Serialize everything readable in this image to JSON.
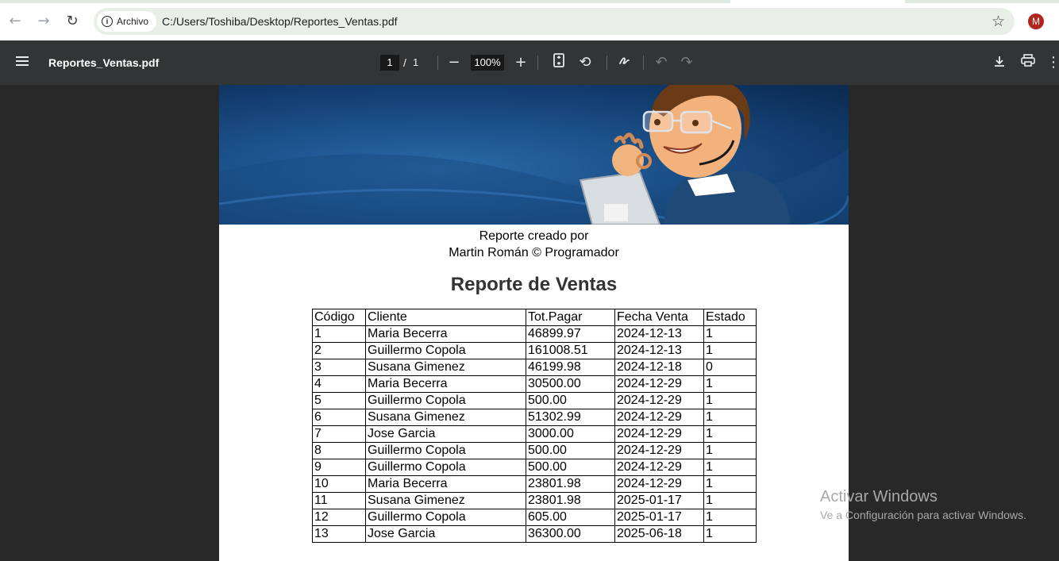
{
  "browser": {
    "security_chip": "Archivo",
    "url": "C:/Users/Toshiba/Desktop/Reportes_Ventas.pdf",
    "profile_initial": "M",
    "profile_color": "#b3261e"
  },
  "pdf_toolbar": {
    "file_name": "Reportes_Ventas.pdf",
    "current_page": "1",
    "separator": "/",
    "total_pages": "1",
    "zoom": "100%"
  },
  "document": {
    "caption_line1": "Reporte creado por",
    "caption_line2": "Martin Román © Programador",
    "title": "Reporte de Ventas",
    "columns": [
      "Código",
      "Cliente",
      "Tot.Pagar",
      "Fecha Venta",
      "Estado"
    ],
    "rows": [
      [
        "1",
        "Maria Becerra",
        "46899.97",
        "2024-12-13",
        "1"
      ],
      [
        "2",
        "Guillermo Copola",
        "161008.51",
        "2024-12-13",
        "1"
      ],
      [
        "3",
        "Susana Gimenez",
        "46199.98",
        "2024-12-18",
        "0"
      ],
      [
        "4",
        "Maria Becerra",
        "30500.00",
        "2024-12-29",
        "1"
      ],
      [
        "5",
        "Guillermo Copola",
        "500.00",
        "2024-12-29",
        "1"
      ],
      [
        "6",
        "Susana Gimenez",
        "51302.99",
        "2024-12-29",
        "1"
      ],
      [
        "7",
        "Jose Garcia",
        "3000.00",
        "2024-12-29",
        "1"
      ],
      [
        "8",
        "Guillermo Copola",
        "500.00",
        "2024-12-29",
        "1"
      ],
      [
        "9",
        "Guillermo Copola",
        "500.00",
        "2024-12-29",
        "1"
      ],
      [
        "10",
        "Maria Becerra",
        "23801.98",
        "2024-12-29",
        "1"
      ],
      [
        "11",
        "Susana Gimenez",
        "23801.98",
        "2025-01-17",
        "1"
      ],
      [
        "12",
        "Guillermo Copola",
        "605.00",
        "2025-01-17",
        "1"
      ],
      [
        "13",
        "Jose Garcia",
        "36300.00",
        "2025-06-18",
        "1"
      ]
    ]
  },
  "watermark": {
    "line1": "Activar Windows",
    "line2": "Ve a Configuración para activar Windows."
  }
}
